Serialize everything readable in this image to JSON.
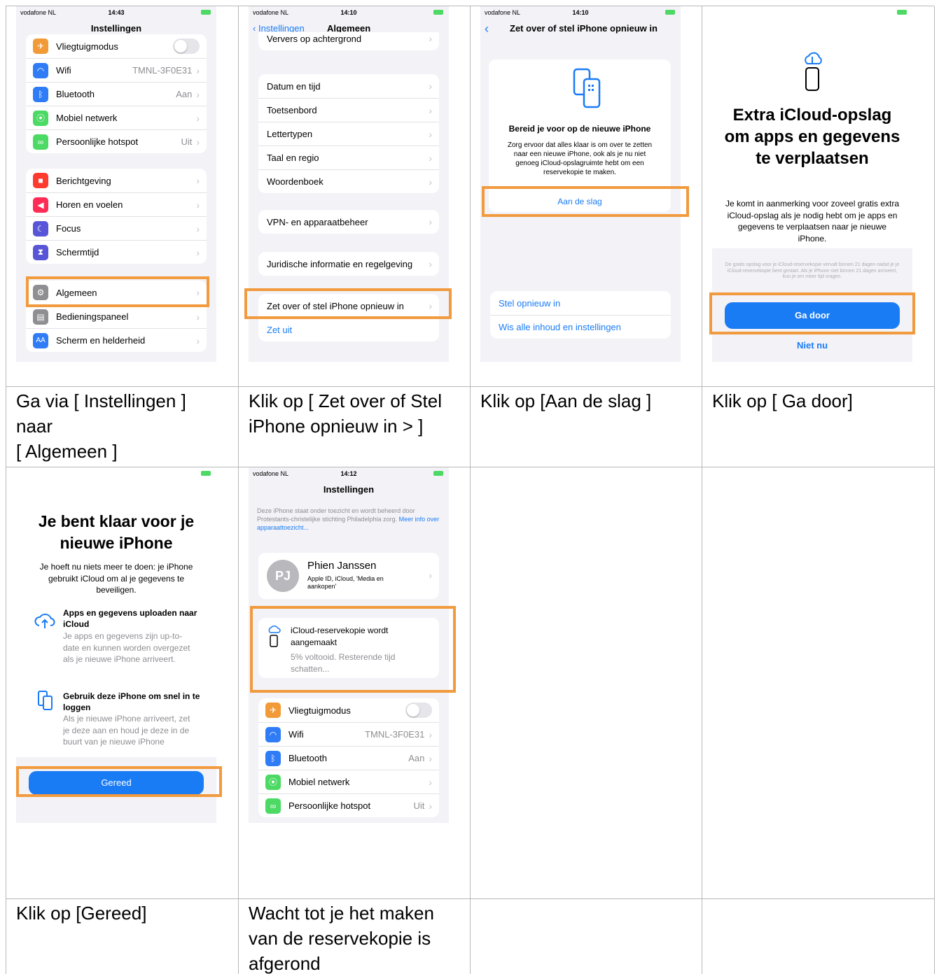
{
  "captions": [
    [
      "Ga via [ Instellingen ]",
      "naar",
      "[ Algemeen ]"
    ],
    [
      "Klik op  [ Zet over of Stel",
      "iPhone opnieuw in > ]"
    ],
    [
      "Klik op [Aan de slag ]"
    ],
    [
      "Klik op [ Ga door]"
    ],
    [
      "Klik op [Gereed]"
    ],
    [
      "Wacht tot je het maken",
      "van de reservekopie is",
      "afgerond"
    ]
  ],
  "phone1": {
    "carrier": "vodafone NL",
    "time": "14:43",
    "title": "Instellingen",
    "group1": [
      {
        "label": "Vliegtuigmodus",
        "value": "",
        "icon": "airplane-icon",
        "color": "#f19a37"
      },
      {
        "label": "Wifi",
        "value": "TMNL-3F0E31",
        "icon": "wifi-icon",
        "color": "#2f7cf6"
      },
      {
        "label": "Bluetooth",
        "value": "Aan",
        "icon": "bluetooth-icon",
        "color": "#2f7cf6"
      },
      {
        "label": "Mobiel netwerk",
        "value": "",
        "icon": "antenna-icon",
        "color": "#4cd964"
      },
      {
        "label": "Persoonlijke hotspot",
        "value": "Uit",
        "icon": "hotspot-icon",
        "color": "#4cd964"
      }
    ],
    "group2": [
      {
        "label": "Berichtgeving",
        "icon": "bell-icon",
        "color": "#ff3b30"
      },
      {
        "label": "Horen en voelen",
        "icon": "speaker-icon",
        "color": "#ff2d55"
      },
      {
        "label": "Focus",
        "icon": "moon-icon",
        "color": "#5856d6"
      },
      {
        "label": "Schermtijd",
        "icon": "hourglass-icon",
        "color": "#5856d6"
      }
    ],
    "group3": [
      {
        "label": "Algemeen",
        "icon": "gear-icon",
        "color": "#8e8e93"
      },
      {
        "label": "Bedieningspaneel",
        "icon": "toggles-icon",
        "color": "#8e8e93"
      },
      {
        "label": "Scherm en helderheid",
        "icon": "aa-icon",
        "color": "#2f7cf6"
      }
    ]
  },
  "phone2": {
    "carrier": "vodafone NL",
    "time": "14:10",
    "back": "Instellingen",
    "title": "Algemeen",
    "top_row": "Ververs op achtergrond",
    "group1": [
      "Datum en tijd",
      "Toetsenbord",
      "Lettertypen",
      "Taal en regio",
      "Woordenboek"
    ],
    "vpn": "VPN- en apparaatbeheer",
    "legal": "Juridische informatie en regelgeving",
    "transfer": "Zet over of stel iPhone opnieuw in",
    "shutdown": "Zet uit"
  },
  "phone3": {
    "carrier": "vodafone NL",
    "time": "14:10",
    "title": "Zet over of stel iPhone opnieuw in",
    "card_title": "Bereid je voor op de nieuwe iPhone",
    "card_body": "Zorg ervoor dat alles klaar is om over te zetten naar een nieuwe iPhone, ook als je nu niet genoeg iCloud-opslagruimte hebt om een reservekopie te maken.",
    "start": "Aan de slag",
    "reset": "Stel opnieuw in",
    "erase": "Wis alle inhoud en instellingen"
  },
  "phone4": {
    "title": "Extra iCloud-opslag om apps en gegevens te verplaatsen",
    "body": "Je komt in aanmerking voor zoveel gratis extra iCloud-opslag als je nodig hebt om je apps en gegevens te verplaatsen naar je nieuwe iPhone.",
    "fine_print": "De gratis opslag voor je iCloud-reservekopie vervalt binnen 21 dagen nadat je je iCloud-reservekopie bent gestart. Als je iPhone niet binnen 21 dagen arriveert, kun je om meer tijd vragen.",
    "continue": "Ga door",
    "not_now": "Niet nu"
  },
  "phone5": {
    "title": "Je bent klaar voor je nieuwe iPhone",
    "body": "Je hoeft nu niets meer te doen: je iPhone gebruikt iCloud om al je gegevens te beveiligen.",
    "item1_title": "Apps en gegevens uploaden naar iCloud",
    "item1_body": "Je apps en gegevens zijn up-to-date en kunnen worden overgezet als je nieuwe iPhone arriveert.",
    "item2_title": "Gebruik deze iPhone om snel in te loggen",
    "item2_body": "Als je nieuwe iPhone arriveert, zet je deze aan en houd je deze in de buurt van je nieuwe iPhone",
    "done": "Gereed"
  },
  "phone6": {
    "carrier": "vodafone NL",
    "time": "14:12",
    "title": "Instellingen",
    "notice": "Deze iPhone staat onder toezicht en wordt beheerd door Protestants-christelijke stichting Philadelphia zorg.",
    "notice_link": "Meer info over apparaattoezicht...",
    "initials": "PJ",
    "name": "Phien Janssen",
    "account_sub": "Apple ID, iCloud, 'Media en aankopen'",
    "backup_title": "iCloud-reservekopie wordt aangemaakt",
    "backup_status": "5% voltooid. Resterende tijd schatten...",
    "rows": [
      {
        "label": "Vliegtuigmodus",
        "value": "",
        "icon": "airplane-icon",
        "color": "#f19a37"
      },
      {
        "label": "Wifi",
        "value": "TMNL-3F0E31",
        "icon": "wifi-icon",
        "color": "#2f7cf6"
      },
      {
        "label": "Bluetooth",
        "value": "Aan",
        "icon": "bluetooth-icon",
        "color": "#2f7cf6"
      },
      {
        "label": "Mobiel netwerk",
        "value": "",
        "icon": "antenna-icon",
        "color": "#4cd964"
      },
      {
        "label": "Persoonlijke hotspot",
        "value": "Uit",
        "icon": "hotspot-icon",
        "color": "#4cd964"
      }
    ]
  },
  "highlight_color": "#f19a3e"
}
